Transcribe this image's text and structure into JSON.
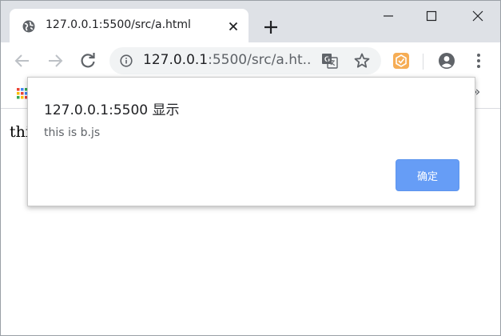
{
  "browser": {
    "tab": {
      "title": "127.0.0.1:5500/src/a.html"
    },
    "omnibox": {
      "url_host": "127.0.0.1",
      "url_path": ":5500/src/a.ht..."
    },
    "bookmarks_overflow": "»"
  },
  "page": {
    "visible_text": "thi"
  },
  "dialog": {
    "title": "127.0.0.1:5500 显示",
    "message": "this is b.js",
    "ok_label": "确定"
  },
  "colors": {
    "tabstrip": "#dee1e6",
    "ok_button": "#669df6",
    "extension": "#f6ad55"
  },
  "icons": {
    "tab_favicon": "globe-icon",
    "tab_close": "close-icon",
    "new_tab": "plus-icon",
    "minimize": "minimize-icon",
    "maximize": "maximize-icon",
    "window_close": "close-icon",
    "back": "back-arrow-icon",
    "forward": "forward-arrow-icon",
    "reload": "reload-icon",
    "site_info": "info-icon",
    "translate": "translate-icon",
    "bookmark": "star-icon",
    "extension": "extension-icon",
    "profile": "profile-icon",
    "menu": "kebab-menu-icon",
    "apps": "apps-grid-icon"
  }
}
